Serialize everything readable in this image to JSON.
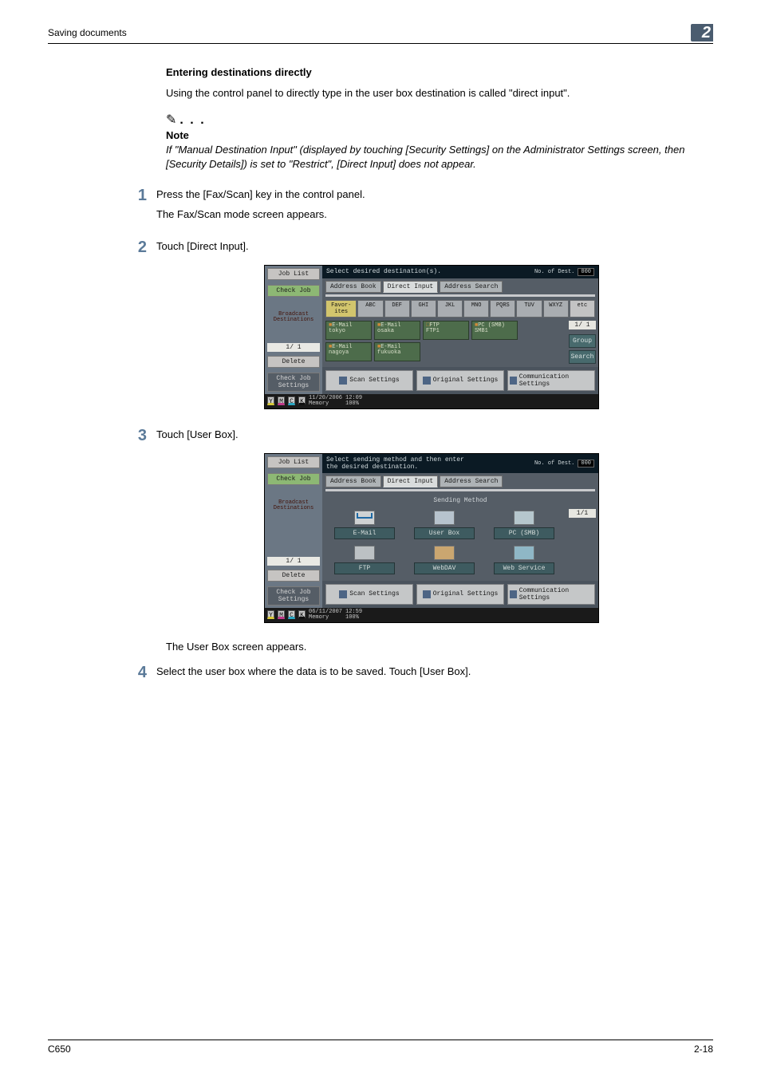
{
  "header": {
    "section": "Saving documents",
    "chapter": "2"
  },
  "subheading": "Entering destinations directly",
  "intro": "Using the control panel to directly type in the user box destination is called \"direct input\".",
  "note": {
    "label": "Note",
    "text": "If \"Manual Destination Input\" (displayed by touching [Security Settings] on the Administrator Settings screen, then [Security Details]) is set to \"Restrict\", [Direct Input] does not appear."
  },
  "steps": {
    "1": {
      "text": "Press the [Fax/Scan] key in the control panel.",
      "sub": "The Fax/Scan mode screen appears."
    },
    "2": {
      "text": "Touch [Direct Input]."
    },
    "3": {
      "text": "Touch [User Box].",
      "sub": "The User Box screen appears."
    },
    "4": {
      "text": "Select the user box where the data is to be saved. Touch [User Box]."
    }
  },
  "footer": {
    "left": "C650",
    "right": "2-18"
  },
  "shot_common": {
    "side": {
      "joblist": "Job List",
      "checkjob": "Check Job",
      "broadcast": "Broadcast\nDestinations",
      "page": "1/  1",
      "delete": "Delete",
      "checkjobset": "Check Job\nSettings"
    },
    "destlabel": "No. of\nDest.",
    "destcount": "000",
    "tabs": {
      "book": "Address Book",
      "direct": "Direct Input",
      "search": "Address\nSearch"
    },
    "bottom": {
      "scan": "Scan Settings",
      "orig": "Original Settings",
      "comm": "Communication\nSettings"
    },
    "toners": [
      "Y",
      "M",
      "C",
      "K"
    ]
  },
  "shot1": {
    "title": "Select desired destination(s).",
    "letters": {
      "fav": "Favor-\nites",
      "keys": [
        "ABC",
        "DEF",
        "GHI",
        "JKL",
        "MNO",
        "PQRS",
        "TUV",
        "WXYZ"
      ],
      "etc": "etc"
    },
    "cards": [
      {
        "t1": "E-Mail",
        "t2": "tokyo"
      },
      {
        "t1": "E-Mail",
        "t2": "osaka"
      },
      {
        "t1": "FTP",
        "t2": "FTP1"
      },
      {
        "t1": "PC (SMB)",
        "t2": "SMB1"
      },
      {
        "t1": "E-Mail",
        "t2": "nagoya"
      },
      {
        "t1": "E-Mail",
        "t2": "fukuoka"
      }
    ],
    "right": {
      "page": "1/  1",
      "group": "Group",
      "search": "Search"
    },
    "status": {
      "date": "11/20/2006",
      "time": "12:09",
      "mem": "Memory",
      "pct": "100%"
    }
  },
  "shot2": {
    "title": "Select sending method and then enter\nthe desired destination.",
    "smtitle": "Sending Method",
    "methods": [
      "E-Mail",
      "User Box",
      "PC (SMB)",
      "FTP",
      "WebDAV",
      "Web Service"
    ],
    "right": {
      "page": "1/1"
    },
    "status": {
      "date": "06/11/2007",
      "time": "12:59",
      "mem": "Memory",
      "pct": "100%"
    }
  }
}
